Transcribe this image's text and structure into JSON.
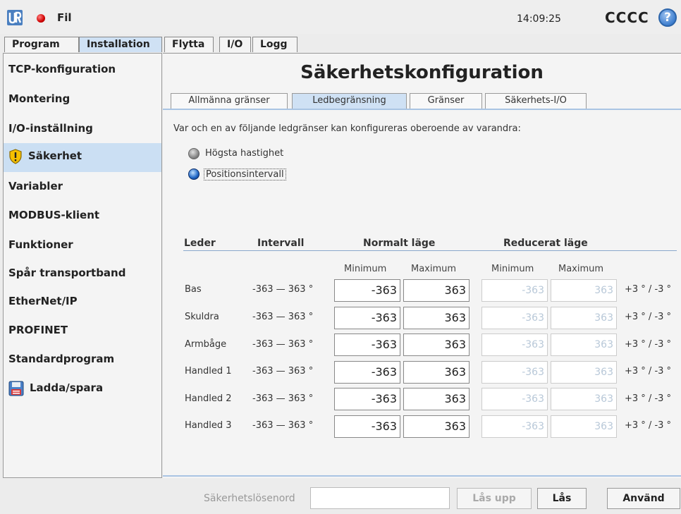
{
  "topbar": {
    "menu_label": "Fil",
    "time": "14:09:25",
    "robot_name": "CCCC",
    "help_glyph": "?"
  },
  "tabs": [
    {
      "label": "Program"
    },
    {
      "label": "Installation"
    },
    {
      "label": "Flytta"
    },
    {
      "label": "I/O"
    },
    {
      "label": "Logg"
    }
  ],
  "sidebar": {
    "items": [
      {
        "label": "TCP-konfiguration"
      },
      {
        "label": "Montering"
      },
      {
        "label": "I/O-inställning"
      },
      {
        "label": "Säkerhet",
        "icon": "warning-shield-icon"
      },
      {
        "label": "Variabler"
      },
      {
        "label": "MODBUS-klient"
      },
      {
        "label": "Funktioner"
      },
      {
        "label": "Spår transportband"
      },
      {
        "label": "EtherNet/IP"
      },
      {
        "label": "PROFINET"
      },
      {
        "label": "Standardprogram"
      },
      {
        "label": "Ladda/spara",
        "icon": "floppy-disk-icon"
      }
    ]
  },
  "main": {
    "title": "Säkerhetskonfiguration",
    "subtabs": [
      {
        "label": "Allmänna gränser"
      },
      {
        "label": "Ledbegränsning"
      },
      {
        "label": "Gränser"
      },
      {
        "label": "Säkerhets-I/O"
      }
    ],
    "description": "Var och en av följande ledgränser kan konfigureras oberoende av varandra:",
    "options": [
      {
        "label": "Högsta hastighet",
        "selected": false
      },
      {
        "label": "Positionsintervall",
        "selected": true
      }
    ],
    "table": {
      "headers": {
        "joint": "Leder",
        "range": "Intervall",
        "normal": "Normalt läge",
        "reduced": "Reducerat läge"
      },
      "subheaders": {
        "min": "Minimum",
        "max": "Maximum"
      },
      "rows": [
        {
          "joint": "Bas",
          "range": "-363 — 363 °",
          "normal_min": "-363",
          "normal_max": "363",
          "reduced_min": "-363",
          "reduced_max": "363",
          "tolerance": "+3 ° / -3 °"
        },
        {
          "joint": "Skuldra",
          "range": "-363 — 363 °",
          "normal_min": "-363",
          "normal_max": "363",
          "reduced_min": "-363",
          "reduced_max": "363",
          "tolerance": "+3 ° / -3 °"
        },
        {
          "joint": "Armbåge",
          "range": "-363 — 363 °",
          "normal_min": "-363",
          "normal_max": "363",
          "reduced_min": "-363",
          "reduced_max": "363",
          "tolerance": "+3 ° / -3 °"
        },
        {
          "joint": "Handled 1",
          "range": "-363 — 363 °",
          "normal_min": "-363",
          "normal_max": "363",
          "reduced_min": "-363",
          "reduced_max": "363",
          "tolerance": "+3 ° / -3 °"
        },
        {
          "joint": "Handled 2",
          "range": "-363 — 363 °",
          "normal_min": "-363",
          "normal_max": "363",
          "reduced_min": "-363",
          "reduced_max": "363",
          "tolerance": "+3 ° / -3 °"
        },
        {
          "joint": "Handled 3",
          "range": "-363 — 363 °",
          "normal_min": "-363",
          "normal_max": "363",
          "reduced_min": "-363",
          "reduced_max": "363",
          "tolerance": "+3 ° / -3 °"
        }
      ]
    }
  },
  "bottombar": {
    "password_label": "Säkerhetslösenord",
    "password_value": "",
    "unlock_label": "Lås upp",
    "lock_label": "Lås",
    "apply_label": "Använd"
  },
  "colors": {
    "selected_bg": "#cbdff3",
    "accent_line": "#a9c4e3",
    "disabled_text": "#b8c8d8"
  }
}
